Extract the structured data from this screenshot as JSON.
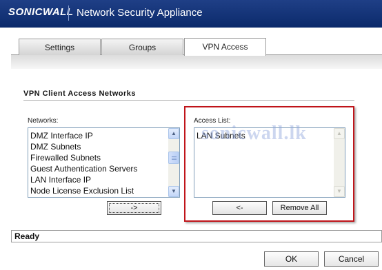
{
  "header": {
    "logo": "SONICWALL",
    "title": "Network Security Appliance"
  },
  "tabs": [
    {
      "label": "Settings",
      "active": false
    },
    {
      "label": "Groups",
      "active": false
    },
    {
      "label": "VPN Access",
      "active": true
    }
  ],
  "section": {
    "title": "VPN Client Access Networks"
  },
  "networks": {
    "label": "Networks:",
    "items": [
      "DMZ Interface IP",
      "DMZ Subnets",
      "Firewalled Subnets",
      "Guest Authentication Servers",
      "LAN Interface IP",
      "Node License Exclusion List"
    ],
    "add_button": "->"
  },
  "access_list": {
    "label": "Access List:",
    "items": [
      "LAN Subnets"
    ],
    "remove_button": "<-",
    "remove_all_button": "Remove All"
  },
  "watermark": "sonicwall.lk",
  "status": {
    "text": "Ready"
  },
  "footer": {
    "ok_label": "OK",
    "cancel_label": "Cancel"
  },
  "colors": {
    "header_bg": "#0b2a6b",
    "highlight_border": "#c0141a"
  },
  "icons": {
    "scroll_up": "▲",
    "scroll_down": "▼"
  }
}
